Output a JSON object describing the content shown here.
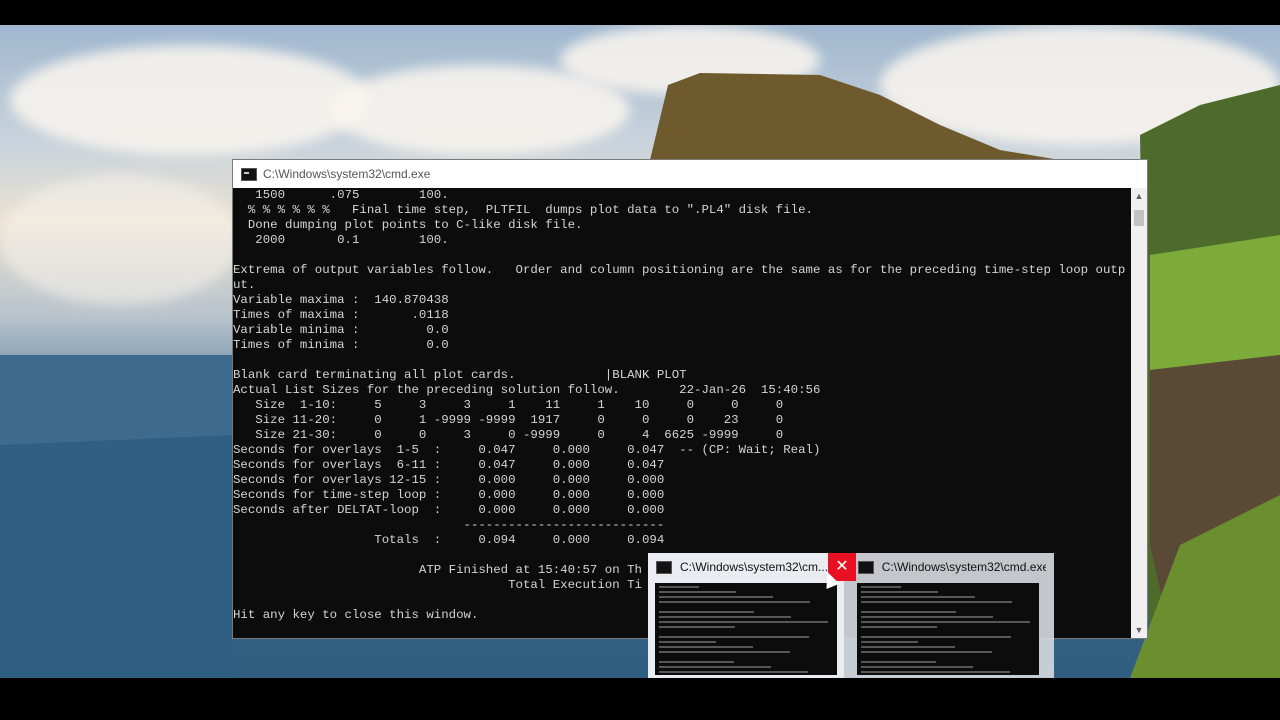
{
  "window": {
    "title": "C:\\Windows\\system32\\cmd.exe"
  },
  "console": {
    "lines": [
      "   1500      .075        100.",
      "  % % % % % %   Final time step,  PLTFIL  dumps plot data to \".PL4\" disk file.",
      "  Done dumping plot points to C-like disk file.",
      "   2000       0.1        100.",
      "",
      "Extrema of output variables follow.   Order and column positioning are the same as for the preceding time-step loop outp",
      "ut.",
      "Variable maxima :  140.870438",
      "Times of maxima :       .0118",
      "Variable minima :         0.0",
      "Times of minima :         0.0",
      "",
      "Blank card terminating all plot cards.            |BLANK PLOT",
      "Actual List Sizes for the preceding solution follow.        22-Jan-26  15:40:56",
      "   Size  1-10:     5     3     3     1    11     1    10     0     0     0",
      "   Size 11-20:     0     1 -9999 -9999  1917     0     0     0    23     0",
      "   Size 21-30:     0     0     3     0 -9999     0     4  6625 -9999     0",
      "Seconds for overlays  1-5  :     0.047     0.000     0.047  -- (CP: Wait; Real)",
      "Seconds for overlays  6-11 :     0.047     0.000     0.047",
      "Seconds for overlays 12-15 :     0.000     0.000     0.000",
      "Seconds for time-step loop :     0.000     0.000     0.000",
      "Seconds after DELTAT-loop  :     0.000     0.000     0.000",
      "                               ---------------------------",
      "                   Totals  :     0.094     0.000     0.094",
      "",
      "                         ATP Finished at 15:40:57 on Th",
      "                                     Total Execution Ti",
      "",
      "Hit any key to close this window."
    ]
  },
  "taskbar_previews": [
    {
      "title": "C:\\Windows\\system32\\cm...",
      "close_label": "✕"
    },
    {
      "title": "C:\\Windows\\system32\\cmd.exe"
    }
  ],
  "scrollbar": {
    "up_arrow": "▲",
    "down_arrow": "▼"
  }
}
